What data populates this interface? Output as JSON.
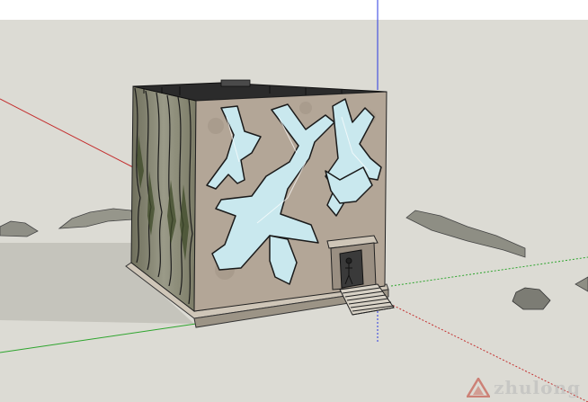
{
  "scene": {
    "sky_color": "#ffffff",
    "ground_color": "#dcdbd4",
    "shadow_color": "#c3c2bb",
    "axes": {
      "red": "#c43030",
      "green": "#2ea52e",
      "blue": "#2a3ae0"
    },
    "facade_color": "#b3a697",
    "side_color": "#8c8c78",
    "glass_color": "#c9e8ee",
    "roof_color": "#2b2b2b"
  },
  "watermark": {
    "text": "zhulong",
    "logo_color": "#c0392b"
  }
}
